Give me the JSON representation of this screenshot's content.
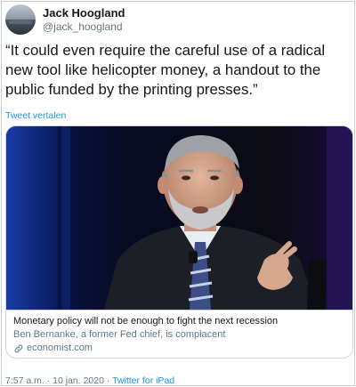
{
  "author": {
    "display_name": "Jack Hoogland",
    "handle": "@jack_hoogland"
  },
  "tweet": {
    "text": "“It could even require the careful use of a radical new tool like helicopter money, a handout to the public funded by the printing presses.”",
    "translate_label": "Tweet vertalen"
  },
  "card": {
    "title": "Monetary policy will not be enough to fight the next recession",
    "description": "Ben Bernanke, a former Fed chief, is complacent",
    "domain": "economist.com",
    "link_icon": "link-icon"
  },
  "meta": {
    "time": "7:57 a.m.",
    "separator1": " · ",
    "date": "10 jan. 2020",
    "separator2": " · ",
    "source": "Twitter for iPad"
  },
  "colors": {
    "link": "#1b95e0",
    "secondary_text": "#657786",
    "border": "#ccd6dd"
  }
}
